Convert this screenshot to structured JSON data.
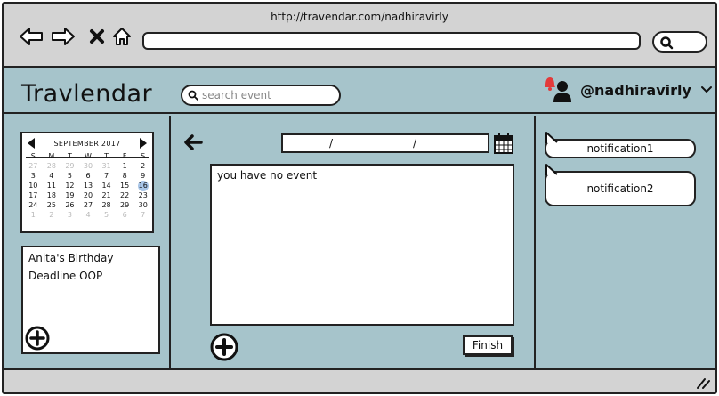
{
  "browser": {
    "url": "http://travendar.com/nadhiravirly",
    "address_value": ""
  },
  "app": {
    "title": "Travlendar",
    "search_placeholder": "search event",
    "username": "@nadhiravirly",
    "notification_color": "#e23b3b"
  },
  "calendar": {
    "month_label": "SEPTEMBER 2017",
    "weekdays": [
      "S",
      "M",
      "T",
      "W",
      "T",
      "F",
      "S"
    ],
    "days": [
      {
        "d": "27",
        "m": true
      },
      {
        "d": "28",
        "m": true
      },
      {
        "d": "29",
        "m": true
      },
      {
        "d": "30",
        "m": true
      },
      {
        "d": "31",
        "m": true
      },
      {
        "d": "1"
      },
      {
        "d": "2"
      },
      {
        "d": "3"
      },
      {
        "d": "4"
      },
      {
        "d": "5"
      },
      {
        "d": "6"
      },
      {
        "d": "7"
      },
      {
        "d": "8"
      },
      {
        "d": "9"
      },
      {
        "d": "10"
      },
      {
        "d": "11"
      },
      {
        "d": "12"
      },
      {
        "d": "13"
      },
      {
        "d": "14"
      },
      {
        "d": "15"
      },
      {
        "d": "16",
        "today": true
      },
      {
        "d": "17"
      },
      {
        "d": "18"
      },
      {
        "d": "19"
      },
      {
        "d": "20"
      },
      {
        "d": "21"
      },
      {
        "d": "22"
      },
      {
        "d": "23"
      },
      {
        "d": "24"
      },
      {
        "d": "25"
      },
      {
        "d": "26"
      },
      {
        "d": "27"
      },
      {
        "d": "28"
      },
      {
        "d": "29"
      },
      {
        "d": "30"
      },
      {
        "d": "1",
        "m": true
      },
      {
        "d": "2",
        "m": true
      },
      {
        "d": "3",
        "m": true
      },
      {
        "d": "4",
        "m": true
      },
      {
        "d": "5",
        "m": true
      },
      {
        "d": "6",
        "m": true
      },
      {
        "d": "7",
        "m": true
      }
    ],
    "today_color": "#a9c6e8"
  },
  "events": {
    "items": [
      "Anita's Birthday",
      "Deadline OOP"
    ]
  },
  "editor": {
    "date_sep": "/",
    "empty_message": "you have no event",
    "finish_label": "Finish"
  },
  "notifications": {
    "items": [
      "notification1",
      "notification2"
    ]
  },
  "colors": {
    "app_background": "#a6c4cb",
    "chrome": "#d3d3d3"
  }
}
